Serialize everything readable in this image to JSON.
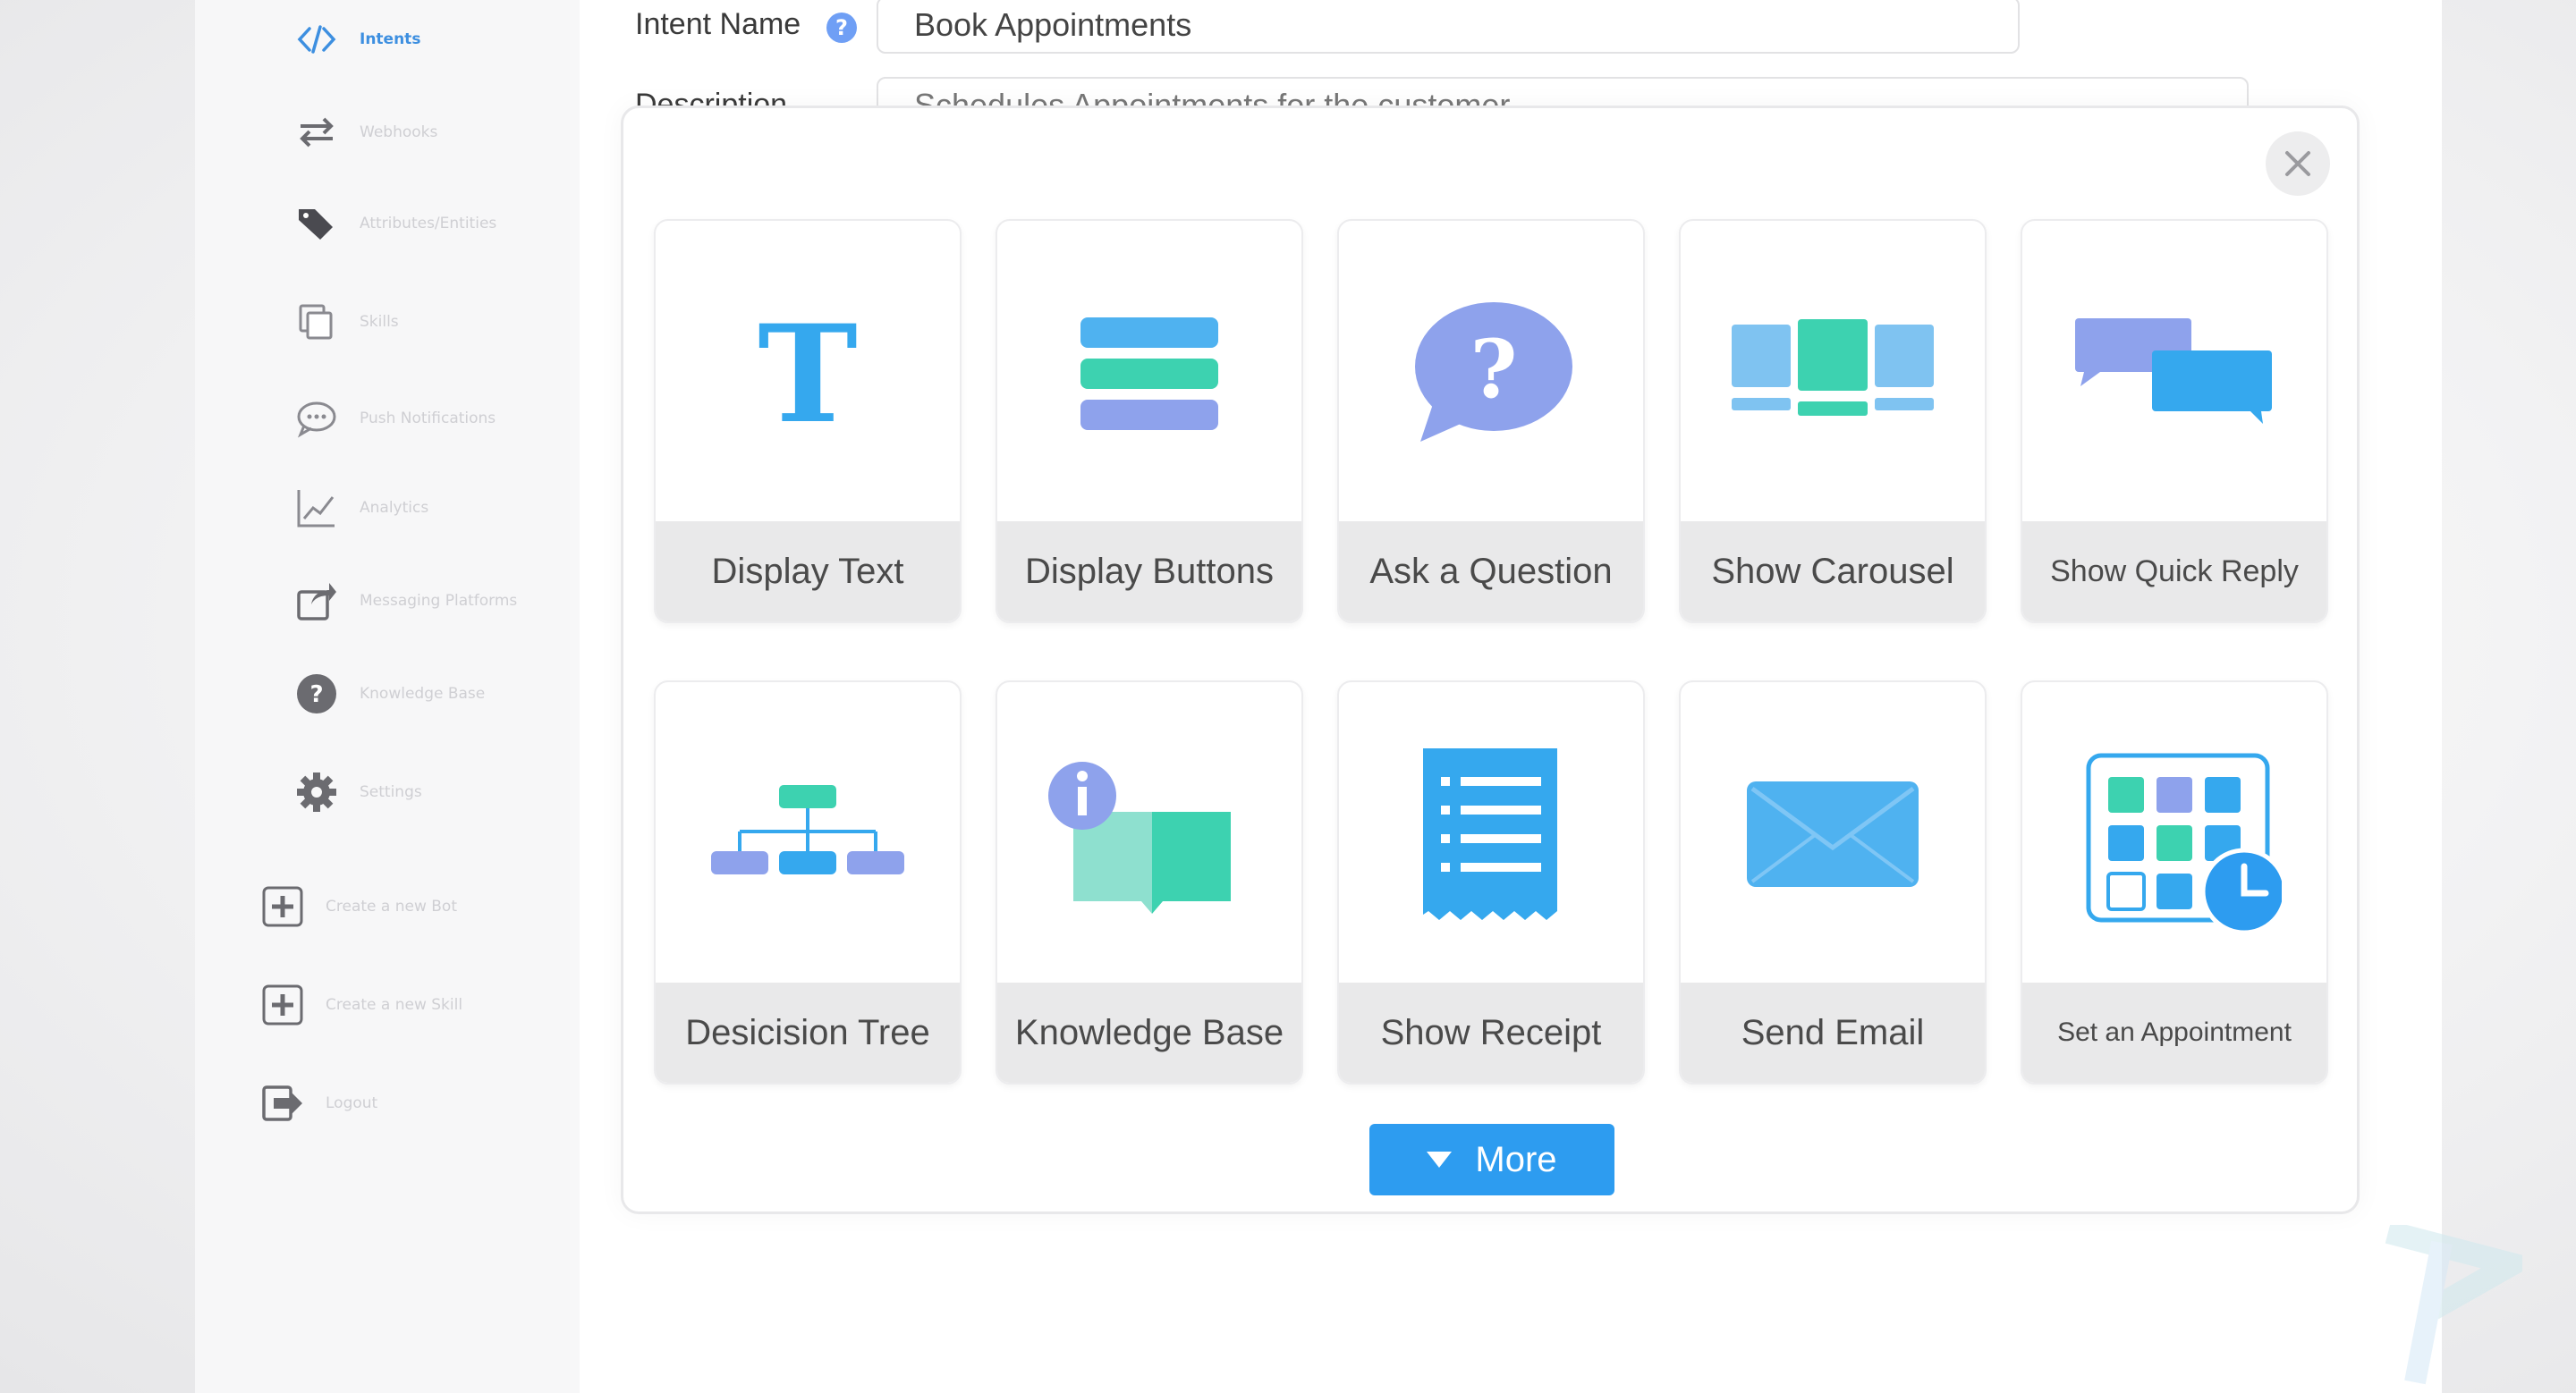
{
  "sidebar": {
    "items": [
      {
        "label": "Intents",
        "icon": "code-icon",
        "active": true
      },
      {
        "label": "Webhooks",
        "icon": "swap-arrows-icon"
      },
      {
        "label": "Attributes/Entities",
        "icon": "tag-icon"
      },
      {
        "label": "Skills",
        "icon": "copy-icon"
      },
      {
        "label": "Push Notifications",
        "icon": "chat-bubble-icon"
      },
      {
        "label": "Analytics",
        "icon": "line-chart-icon"
      },
      {
        "label": "Messaging Platforms",
        "icon": "share-icon"
      },
      {
        "label": "Knowledge Base",
        "icon": "question-circle-icon"
      },
      {
        "label": "Settings",
        "icon": "gear-icon"
      },
      {
        "label": "Create a new Bot",
        "icon": "plus-square-icon"
      },
      {
        "label": "Create a new Skill",
        "icon": "plus-square-icon"
      },
      {
        "label": "Logout",
        "icon": "logout-icon"
      }
    ]
  },
  "form": {
    "intent_name_label": "Intent Name",
    "intent_name_value": "Book Appointments",
    "description_label": "Description",
    "description_value": "Schedules Appointments for the customer"
  },
  "modal": {
    "cards": [
      {
        "label": "Display Text",
        "icon": "text-t-icon"
      },
      {
        "label": "Display Buttons",
        "icon": "buttons-icon"
      },
      {
        "label": "Ask a Question",
        "icon": "question-bubble-icon"
      },
      {
        "label": "Show Carousel",
        "icon": "carousel-icon"
      },
      {
        "label": "Show Quick Reply",
        "icon": "quick-reply-icon"
      },
      {
        "label": "Desicision Tree",
        "icon": "tree-icon"
      },
      {
        "label": "Knowledge Base",
        "icon": "book-info-icon"
      },
      {
        "label": "Show Receipt",
        "icon": "receipt-icon"
      },
      {
        "label": "Send Email",
        "icon": "envelope-icon"
      },
      {
        "label": "Set an Appointment",
        "icon": "calendar-clock-icon"
      }
    ],
    "more_label": "More"
  },
  "colors": {
    "accent": "#2d9cf0",
    "active_nav": "#3d8fe0",
    "teal": "#3dd2b0",
    "lavender": "#8ea2ec",
    "sky": "#7fc3f1"
  }
}
